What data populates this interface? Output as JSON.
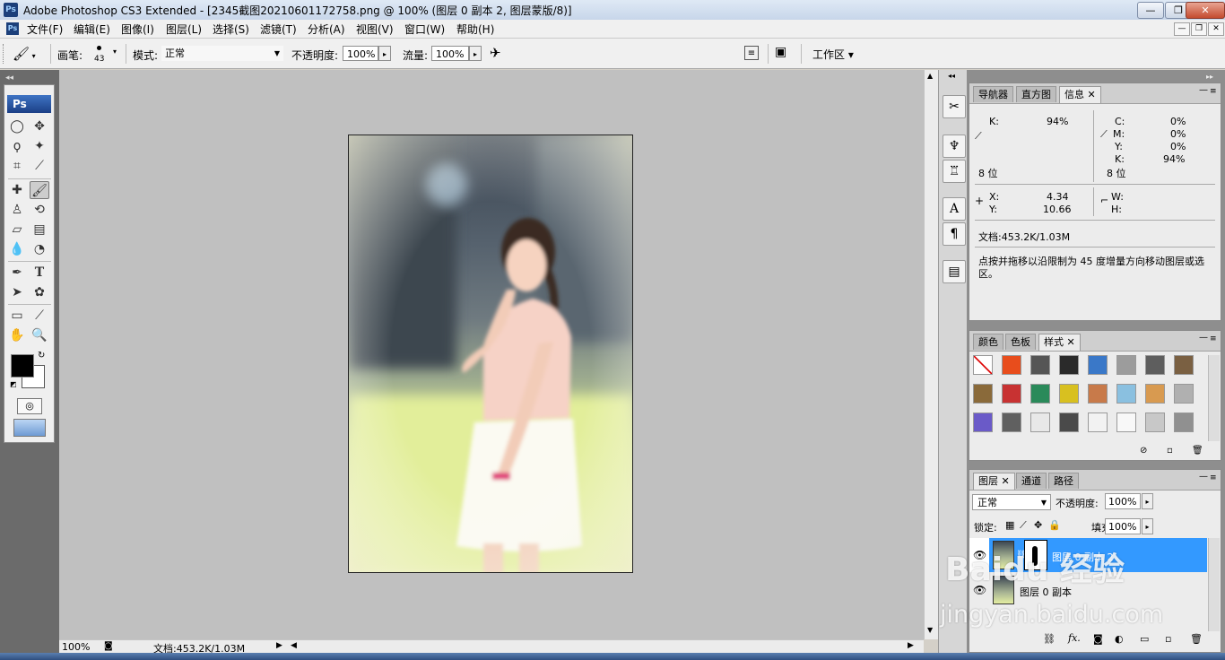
{
  "window": {
    "title": "Adobe Photoshop CS3 Extended - [2345截图20210601172758.png @ 100% (图层 0 副本 2, 图层蒙版/8)]",
    "app_icon": "Ps",
    "minimize": "—",
    "restore": "❐",
    "close": "✕"
  },
  "menu": {
    "items": [
      "文件(F)",
      "编辑(E)",
      "图像(I)",
      "图层(L)",
      "选择(S)",
      "滤镜(T)",
      "分析(A)",
      "视图(V)",
      "窗口(W)",
      "帮助(H)"
    ]
  },
  "options": {
    "brush_label": "画笔:",
    "brush_size": "43",
    "mode_label": "模式:",
    "mode_value": "正常",
    "opacity_label": "不透明度:",
    "opacity_value": "100%",
    "flow_label": "流量:",
    "flow_value": "100%",
    "workspace_label": "工作区 ▾"
  },
  "toolbox": {
    "logo": "Ps"
  },
  "status": {
    "zoom": "100%",
    "doc": "文档:453.2K/1.03M"
  },
  "info_panel": {
    "tabs": [
      "导航器",
      "直方图",
      "信息"
    ],
    "k_label": "K:",
    "k_value": "94%",
    "c_label": "C:",
    "c_value": "0%",
    "m_label": "M:",
    "m_value": "0%",
    "y_label": "Y:",
    "y_value": "0%",
    "k2_label": "K:",
    "k2_value": "94%",
    "bits_left": "8 位",
    "bits_right": "8 位",
    "x_label": "X:",
    "x_value": "4.34",
    "y2_label": "Y:",
    "y2_value": "10.66",
    "w_label": "W:",
    "h_label": "H:",
    "doc": "文档:453.2K/1.03M",
    "hint": "点按并拖移以沿限制为 45 度增量方向移动图层或选区。"
  },
  "styles_panel": {
    "tabs": [
      "颜色",
      "色板",
      "样式"
    ]
  },
  "layers_panel": {
    "tabs": [
      "图层",
      "通道",
      "路径"
    ],
    "blend_mode": "正常",
    "opacity_label": "不透明度:",
    "opacity_value": "100%",
    "lock_label": "锁定:",
    "fill_label": "填充:",
    "fill_value": "100%",
    "layers": [
      {
        "name": "图层 0 副本 2",
        "selected": true
      },
      {
        "name": "图层 0 副本",
        "selected": false
      }
    ]
  },
  "watermark": {
    "line1": "Baidu 经验",
    "line2": "jingyan.baidu.com"
  },
  "colors": {
    "selected_layer": "#3399ff",
    "foreground": "#000000",
    "background": "#ffffff"
  }
}
